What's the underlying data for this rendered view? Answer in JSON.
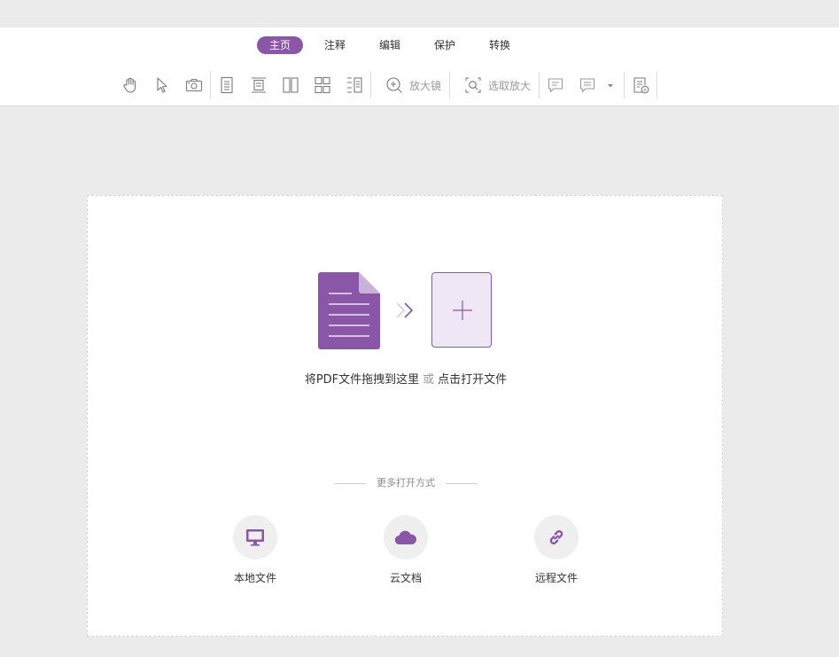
{
  "tabs": [
    {
      "label": "主页",
      "active": true
    },
    {
      "label": "注释",
      "active": false
    },
    {
      "label": "编辑",
      "active": false
    },
    {
      "label": "保护",
      "active": false
    },
    {
      "label": "转换",
      "active": false
    }
  ],
  "toolbar": {
    "magnifier_label": "放大镜",
    "select_zoom_label": "选取放大"
  },
  "drop_zone": {
    "hint_main": "将PDF文件拖拽到这里",
    "hint_or": "或",
    "hint_open": "点击打开文件"
  },
  "more_options": {
    "title": "更多打开方式",
    "items": [
      {
        "label": "本地文件",
        "icon": "monitor-icon"
      },
      {
        "label": "云文档",
        "icon": "cloud-icon"
      },
      {
        "label": "远程文件",
        "icon": "link-icon"
      }
    ]
  },
  "colors": {
    "accent": "#8a56a8",
    "accent_light": "#f0e7f6",
    "background": "#ebebeb"
  }
}
